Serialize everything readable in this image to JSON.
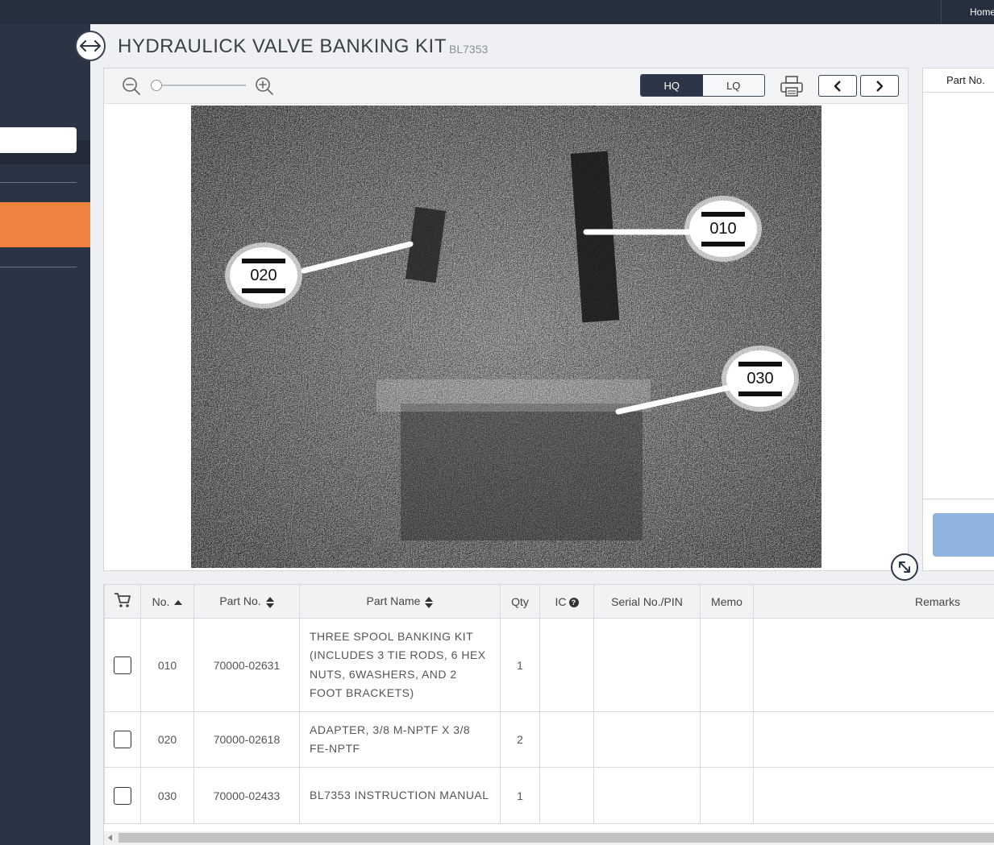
{
  "topbar": {
    "home_label": "Home"
  },
  "page": {
    "title": "HYDRAULICK VALVE BANKING KIT",
    "subtitle": "BL7353"
  },
  "viewer": {
    "quality_hq": "HQ",
    "quality_lq": "LQ",
    "zoom_level": 0,
    "callouts": [
      {
        "label": "010"
      },
      {
        "label": "020"
      },
      {
        "label": "030"
      }
    ],
    "icons": [
      "zoom-out-icon",
      "zoom-in-icon",
      "printer-icon",
      "chevron-left-icon",
      "chevron-right-icon",
      "expand-icon",
      "horizontal-arrows-icon"
    ]
  },
  "right_panel": {
    "header": "Part No."
  },
  "table": {
    "headers": {
      "cart": "cart-icon",
      "no": "No.",
      "part_no": "Part No.",
      "part_name": "Part Name",
      "qty": "Qty",
      "ic": "IC",
      "serial": "Serial No./PIN",
      "memo": "Memo",
      "remarks": "Remarks"
    },
    "rows": [
      {
        "no": "010",
        "part_no": "70000-02631",
        "part_name": "THREE SPOOL BANKING KIT (INCLUDES 3 TIE RODS, 6 HEX NUTS, 6WASHERS, AND 2 FOOT BRACKETS)",
        "qty": "1",
        "ic": "",
        "serial": "",
        "memo": "",
        "remarks": ""
      },
      {
        "no": "020",
        "part_no": "70000-02618",
        "part_name": "ADAPTER, 3/8 M-NPTF X 3/8 FE-NPTF",
        "qty": "2",
        "ic": "",
        "serial": "",
        "memo": "",
        "remarks": ""
      },
      {
        "no": "030",
        "part_no": "70000-02433",
        "part_name": "BL7353 INSTRUCTION MANUAL",
        "qty": "1",
        "ic": "",
        "serial": "",
        "memo": "",
        "remarks": ""
      }
    ]
  },
  "colors": {
    "topbar": "#262f3e",
    "sidebar": "#2b3444",
    "sidebar_active": "#f0823f",
    "quality_active": "#2d3646",
    "right_button": "#8fb3de"
  }
}
